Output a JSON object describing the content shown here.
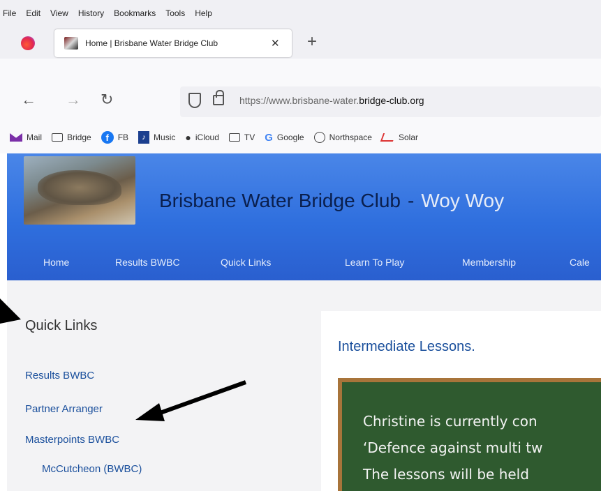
{
  "browser": {
    "menu": [
      "File",
      "Edit",
      "View",
      "History",
      "Bookmarks",
      "Tools",
      "Help"
    ],
    "tab_title": "Home | Brisbane Water Bridge Club",
    "tab_close": "✕",
    "new_tab": "+",
    "nav": {
      "back": "←",
      "forward": "→",
      "reload": "↻"
    },
    "url_prefix": "https://www.brisbane-water.",
    "url_domain": "bridge-club.org",
    "bookmarks": [
      "Mail",
      "Bridge",
      "FB",
      "Music",
      "iCloud",
      "TV",
      "Google",
      "Northspace",
      "Solar"
    ]
  },
  "site": {
    "title": "Brisbane Water Bridge Club",
    "dash": "-",
    "subtitle": "Woy Woy",
    "nav": [
      "Home",
      "Results BWBC",
      "Quick Links",
      "Learn To Play",
      "Membership",
      "Cale"
    ]
  },
  "sidebar": {
    "heading": "Quick Links",
    "links": [
      "Results BWBC",
      "Partner Arranger",
      "Masterpoints BWBC",
      "McCutcheon (BWBC)"
    ]
  },
  "main": {
    "heading": "Intermediate Lessons.",
    "board_lines": [
      "Christine is currently con",
      "‘Defence against multi tw",
      "The lessons will be held"
    ]
  },
  "colors": {
    "header_blue": "#2f6fde",
    "link_blue": "#1a4f9c",
    "board_green": "#2f5a2f",
    "board_frame": "#a8743a"
  }
}
